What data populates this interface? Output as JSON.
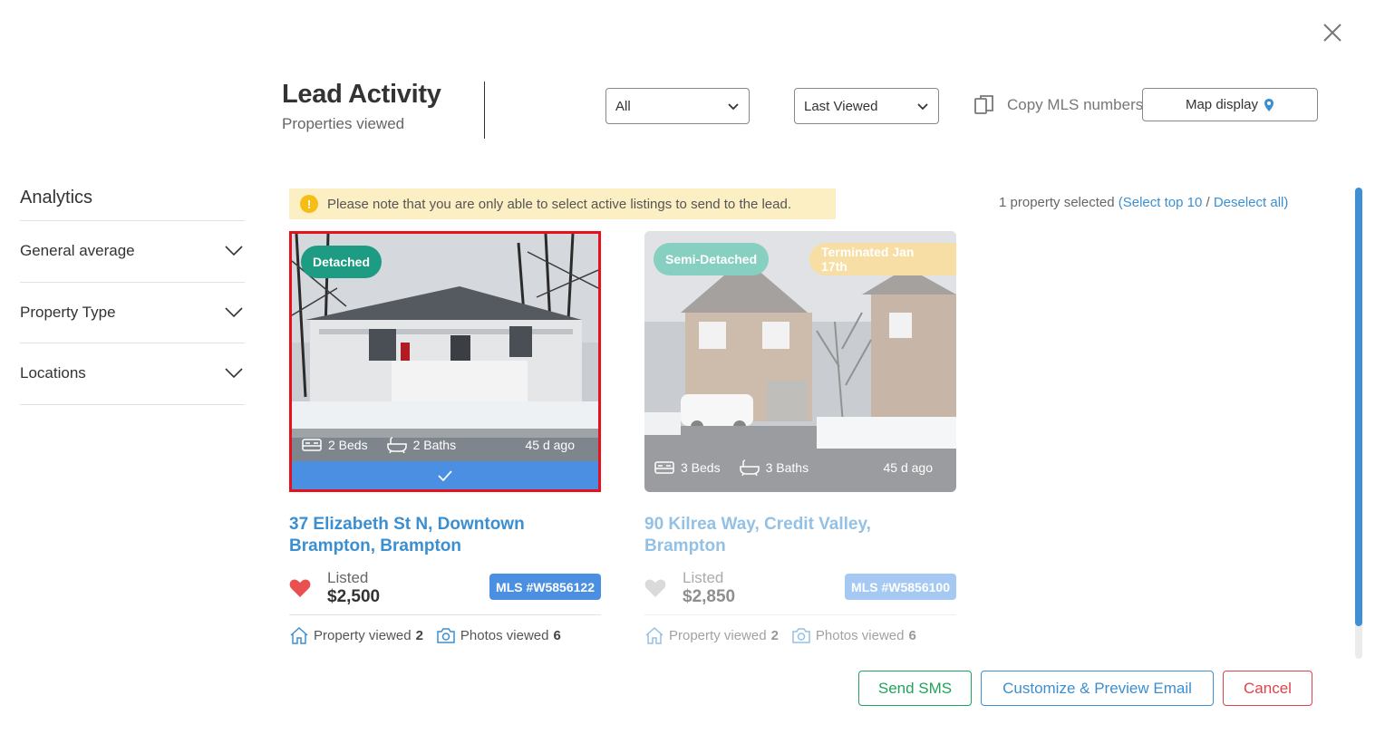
{
  "header": {
    "title": "Lead Activity",
    "subtitle": "Properties viewed",
    "filter_status": "All",
    "filter_sort": "Last Viewed",
    "copy_mls_label": "Copy MLS numbers",
    "map_display_label": "Map display"
  },
  "sidebar": {
    "title": "Analytics",
    "items": [
      {
        "label": "General average"
      },
      {
        "label": "Property Type"
      },
      {
        "label": "Locations"
      }
    ]
  },
  "notice": {
    "icon": "!",
    "text": "Please note that you are only able to select active listings to send to the lead."
  },
  "selection": {
    "count_text": "1 property selected",
    "open_paren": "(",
    "select_top": "Select top 10",
    "separator": " / ",
    "deselect_all": "Deselect all",
    "close_paren": ")"
  },
  "listings": [
    {
      "type": "Detached",
      "beds": "2 Beds",
      "baths": "2 Baths",
      "ago": "45 d ago",
      "address": "37 Elizabeth St N, Downtown Brampton, Brampton",
      "price_label": "Listed",
      "price": "$2,500",
      "mls": "MLS #W5856122",
      "property_viewed_label": "Property viewed",
      "property_viewed_count": "2",
      "photos_viewed_label": "Photos viewed",
      "photos_viewed_count": "6",
      "selected": true,
      "favorite": true
    },
    {
      "type": "Semi-Detached",
      "status": "Terminated Jan 17th",
      "beds": "3 Beds",
      "baths": "3 Baths",
      "ago": "45 d ago",
      "address": "90 Kilrea Way, Credit Valley, Brampton",
      "price_label": "Listed",
      "price": "$2,850",
      "mls": "MLS #W5856100",
      "property_viewed_label": "Property viewed",
      "property_viewed_count": "2",
      "photos_viewed_label": "Photos viewed",
      "photos_viewed_count": "6",
      "selected": false,
      "favorite": false
    }
  ],
  "footer": {
    "send_sms": "Send SMS",
    "customize_email": "Customize & Preview Email",
    "cancel": "Cancel"
  },
  "colors": {
    "accent_blue": "#3b8fd0",
    "selected_border": "#e8101c",
    "badge_green": "#1e9b83",
    "badge_yellow": "#f1c45a",
    "notice_bg": "#fcefc4",
    "sms_green": "#21a35a",
    "cancel_red": "#e2434a",
    "heart_red": "#e8514f"
  }
}
